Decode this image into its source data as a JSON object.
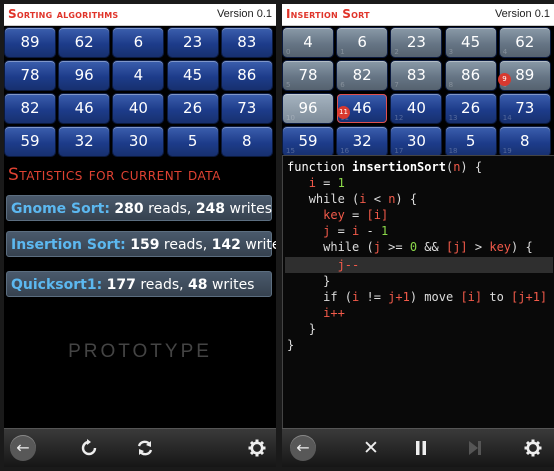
{
  "left": {
    "title": "Sorting algorithms",
    "version": "Version 0.1",
    "grid": [
      [
        "89",
        "62",
        "6",
        "23",
        "83"
      ],
      [
        "78",
        "96",
        "4",
        "45",
        "86"
      ],
      [
        "82",
        "46",
        "40",
        "26",
        "73"
      ],
      [
        "59",
        "32",
        "30",
        "5",
        "8"
      ]
    ],
    "stats_heading": "Statistics for current data",
    "stats": [
      {
        "name": "Gnome Sort:",
        "reads": "280",
        "reads_label": "reads,",
        "writes": "248",
        "writes_label": "writes"
      },
      {
        "name": "Insertion Sort:",
        "reads": "159",
        "reads_label": "reads,",
        "writes": "142",
        "writes_label": "writes"
      },
      {
        "name": "Quicksort1:",
        "reads": "177",
        "reads_label": "reads,",
        "writes": "48",
        "writes_label": "writes"
      }
    ],
    "watermark": "PROTOTYPE",
    "toolbar": [
      "back-icon",
      "refresh-icon",
      "shuffle-icon",
      "settings-icon"
    ]
  },
  "right": {
    "title": "Insertion Sort",
    "version": "Version 0.1",
    "grid": [
      [
        "4",
        "6",
        "23",
        "45",
        "62"
      ],
      [
        "78",
        "82",
        "83",
        "86",
        "89"
      ],
      [
        "96",
        "46",
        "40",
        "26",
        "73"
      ],
      [
        "59",
        "32",
        "30",
        "5",
        "8"
      ]
    ],
    "badges": [
      "9",
      "11"
    ],
    "code": {
      "l1a": "function ",
      "l1b": "insertionSort",
      "l1c": "(",
      "l1d": "n",
      "l1e": ") {",
      "l2a": "i",
      "l2b": " = ",
      "l2c": "1",
      "l3a": "while (",
      "l3b": "i",
      "l3c": " < ",
      "l3d": "n",
      "l3e": ") {",
      "l4a": "key",
      "l4b": " = ",
      "l4c": "[i]",
      "l5a": "j",
      "l5b": " = ",
      "l5c": "i",
      "l5d": " - ",
      "l5e": "1",
      "l6a": "while (",
      "l6b": "j",
      "l6c": " >= ",
      "l6d": "0",
      "l6e": " && ",
      "l6f": "[j]",
      "l6g": " > ",
      "l6h": "key",
      "l6i": ") {",
      "l7a": "j--",
      "l8": "}",
      "l9a": "if (",
      "l9b": "i",
      "l9c": " != ",
      "l9d": "j+1",
      "l9e": ") move ",
      "l9f": "[i]",
      "l9g": " to ",
      "l9h": "[j+1]",
      "l10": "i++",
      "l11": "}",
      "l12": "}"
    },
    "toolbar": [
      "back-icon",
      "stop-icon",
      "pause-icon",
      "step-icon",
      "settings-icon"
    ]
  },
  "colors": {
    "accent": "#e0342a",
    "cell": "#1d3c8a",
    "cell_sorted": "#667585",
    "code_red": "#f25a4a",
    "code_green": "#8bd84a"
  }
}
